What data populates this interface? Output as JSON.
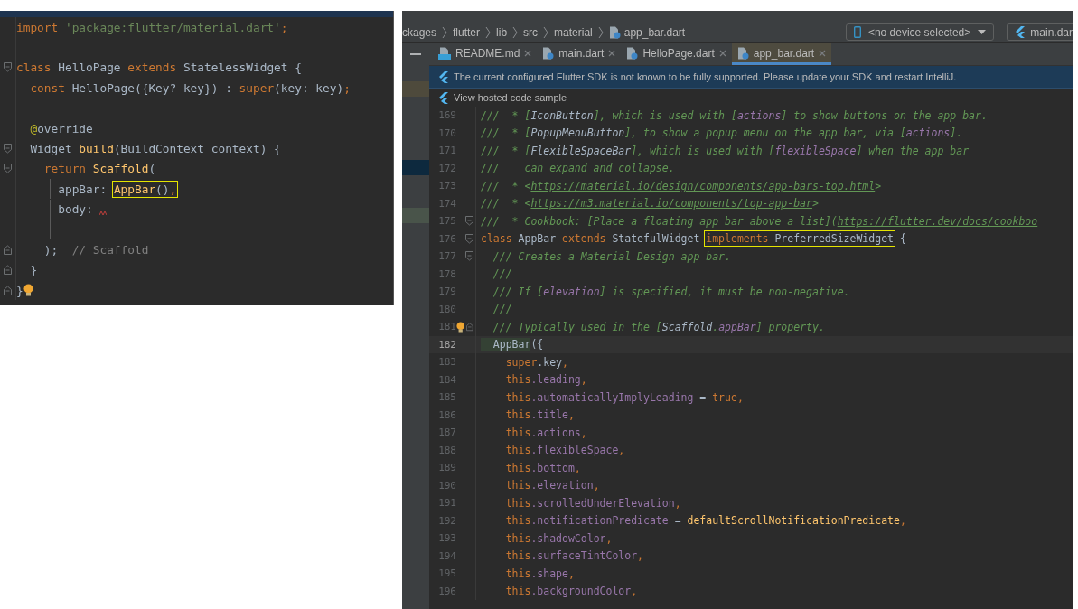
{
  "left_editor": {
    "lines": [
      {
        "kind": "code",
        "tokens": [
          {
            "text": "import",
            "kind": "kw"
          },
          {
            "text": " 'package:flutter/material.dart'",
            "kind": "str"
          },
          {
            "text": ";",
            "kind": "kw"
          }
        ]
      },
      {
        "kind": "blank"
      },
      {
        "fold_open": true,
        "tokens": [
          {
            "text": "class",
            "kind": "kw"
          },
          {
            "text": " HelloPage ",
            "kind": "txt"
          },
          {
            "text": "extends",
            "kind": "kw"
          },
          {
            "text": " StatelessWidget {",
            "kind": "txt"
          }
        ]
      },
      {
        "tokens": [
          {
            "text": "  const",
            "kind": "kw"
          },
          {
            "text": " HelloPage({Key? key}) : ",
            "kind": "txt"
          },
          {
            "text": "super",
            "kind": "kw"
          },
          {
            "text": "(key: key)",
            "kind": "txt"
          },
          {
            "text": ";",
            "kind": "kw"
          }
        ]
      },
      {
        "kind": "blank"
      },
      {
        "tokens": [
          {
            "text": "  @",
            "kind": "ann"
          },
          {
            "text": "override",
            "kind": "txt"
          }
        ]
      },
      {
        "fold_open": true,
        "tokens": [
          {
            "text": "  Widget ",
            "kind": "txt"
          },
          {
            "text": "build",
            "kind": "fn"
          },
          {
            "text": "(BuildContext context) {",
            "kind": "txt"
          }
        ]
      },
      {
        "fold_open": true,
        "tokens": [
          {
            "text": "    return",
            "kind": "kw"
          },
          {
            "text": " Scaffold",
            "kind": "fn"
          },
          {
            "text": "(",
            "kind": "txt"
          }
        ]
      },
      {
        "indent_guide": true,
        "tokens": [
          {
            "text": "      appBar: ",
            "kind": "txt"
          },
          {
            "text": "AppBar",
            "kind": "fn",
            "boxed": true
          },
          {
            "text": "()",
            "kind": "txt",
            "boxed": true
          },
          {
            "text": ",",
            "kind": "kw",
            "boxed": true
          }
        ]
      },
      {
        "indent_guide": true,
        "squiggle": true,
        "tokens": [
          {
            "text": "      body: ",
            "kind": "txt"
          }
        ]
      },
      {
        "kind": "blank",
        "indent_guide": true
      },
      {
        "fold_close": true,
        "tokens": [
          {
            "text": "    );",
            "kind": "txt"
          },
          {
            "text": "  // Scaffold",
            "kind": "cmt"
          }
        ]
      },
      {
        "fold_close": true,
        "tokens": [
          {
            "text": "  }",
            "kind": "txt"
          }
        ]
      },
      {
        "fold_close": true,
        "bulb": true,
        "tokens": [
          {
            "text": "}",
            "kind": "txt"
          }
        ]
      }
    ]
  },
  "ide": {
    "breadcrumbs": [
      "ckages",
      "flutter",
      "lib",
      "src",
      "material",
      "app_bar.dart"
    ],
    "device_selector": "<no device selected>",
    "run_config": "main.dar",
    "tabs": [
      {
        "label": "README.md",
        "kind": "markdown",
        "selected": false
      },
      {
        "label": "main.dart",
        "kind": "dart",
        "selected": false
      },
      {
        "label": "HelloPage.dart",
        "kind": "dart",
        "selected": false
      },
      {
        "label": "app_bar.dart",
        "kind": "dart",
        "selected": true
      }
    ],
    "banner": "The current configured Flutter SDK is not known to be fully supported. Please update your SDK and restart IntelliJ.",
    "code_sample_link": "View hosted code sample",
    "lines": [
      {
        "number": "169",
        "tokens": [
          {
            "text": "///  * [",
            "kind": "doc"
          },
          {
            "text": "IconButton",
            "kind": "dref"
          },
          {
            "text": "], which is used with [",
            "kind": "doc"
          },
          {
            "text": "actions",
            "kind": "dfld"
          },
          {
            "text": "] to show buttons on the app bar.",
            "kind": "doc"
          }
        ]
      },
      {
        "number": "170",
        "tokens": [
          {
            "text": "///  * [",
            "kind": "doc"
          },
          {
            "text": "PopupMenuButton",
            "kind": "dref"
          },
          {
            "text": "], to show a popup menu on the app bar, via [",
            "kind": "doc"
          },
          {
            "text": "actions",
            "kind": "dfld"
          },
          {
            "text": "].",
            "kind": "doc"
          }
        ]
      },
      {
        "number": "171",
        "tokens": [
          {
            "text": "///  * [",
            "kind": "doc"
          },
          {
            "text": "FlexibleSpaceBar",
            "kind": "dref"
          },
          {
            "text": "], which is used with [",
            "kind": "doc"
          },
          {
            "text": "flexibleSpace",
            "kind": "dfld"
          },
          {
            "text": "] when the app bar",
            "kind": "doc"
          }
        ]
      },
      {
        "number": "172",
        "tokens": [
          {
            "text": "///    can expand and collapse.",
            "kind": "doc"
          }
        ]
      },
      {
        "number": "173",
        "tokens": [
          {
            "text": "///  * <",
            "kind": "doc"
          },
          {
            "text": "https://material.io/design/components/app-bars-top.html",
            "kind": "link"
          },
          {
            "text": ">",
            "kind": "doc"
          }
        ]
      },
      {
        "number": "174",
        "tokens": [
          {
            "text": "///  * <",
            "kind": "doc"
          },
          {
            "text": "https://m3.material.io/components/top-app-bar",
            "kind": "link"
          },
          {
            "text": ">",
            "kind": "doc"
          }
        ]
      },
      {
        "number": "175",
        "fold_open": true,
        "tokens": [
          {
            "text": "///  * Cookbook: [Place a floating app bar above a list](",
            "kind": "doc"
          },
          {
            "text": "https://flutter.dev/docs/cookboo",
            "kind": "link"
          }
        ]
      },
      {
        "number": "176",
        "fold_open": true,
        "tokens": [
          {
            "text": "class",
            "kind": "kw"
          },
          {
            "text": " AppBar ",
            "kind": "txt"
          },
          {
            "text": "extends",
            "kind": "kw"
          },
          {
            "text": " StatefulWidget ",
            "kind": "txt"
          },
          {
            "text": "implements",
            "kind": "kw",
            "boxed": true
          },
          {
            "text": " PreferredSizeWidget",
            "kind": "txt",
            "boxed": true
          },
          {
            "text": " {",
            "kind": "txt"
          }
        ]
      },
      {
        "number": "177",
        "fold_open": true,
        "tokens": [
          {
            "text": "  /// Creates a Material Design app bar.",
            "kind": "doc"
          }
        ]
      },
      {
        "number": "178",
        "tokens": [
          {
            "text": "  ///",
            "kind": "doc"
          }
        ]
      },
      {
        "number": "179",
        "tokens": [
          {
            "text": "  /// If [",
            "kind": "doc"
          },
          {
            "text": "elevation",
            "kind": "dfld"
          },
          {
            "text": "] is specified, it must be non-negative.",
            "kind": "doc"
          }
        ]
      },
      {
        "number": "180",
        "tokens": [
          {
            "text": "  ///",
            "kind": "doc"
          }
        ]
      },
      {
        "number": "181",
        "fold_close": true,
        "bulb": true,
        "tokens": [
          {
            "text": "  /// Typically used in the [",
            "kind": "doc"
          },
          {
            "text": "Scaffold",
            "kind": "dref"
          },
          {
            "text": ".",
            "kind": "doc"
          },
          {
            "text": "appBar",
            "kind": "dfld"
          },
          {
            "text": "] property.",
            "kind": "doc"
          }
        ]
      },
      {
        "number": "182",
        "current": true,
        "tokens": [
          {
            "text": "  AppBar",
            "kind": "match"
          },
          {
            "text": "({",
            "kind": "txt"
          }
        ]
      },
      {
        "number": "183",
        "tokens": [
          {
            "text": "    super",
            "kind": "kw"
          },
          {
            "text": ".key",
            "kind": "txt"
          },
          {
            "text": ",",
            "kind": "kw"
          }
        ]
      },
      {
        "number": "184",
        "tokens": [
          {
            "text": "    this",
            "kind": "kw"
          },
          {
            "text": ".leading",
            "kind": "fld"
          },
          {
            "text": ",",
            "kind": "kw"
          }
        ]
      },
      {
        "number": "185",
        "tokens": [
          {
            "text": "    this",
            "kind": "kw"
          },
          {
            "text": ".automaticallyImplyLeading",
            "kind": "fld"
          },
          {
            "text": " = ",
            "kind": "txt"
          },
          {
            "text": "true",
            "kind": "kw"
          },
          {
            "text": ",",
            "kind": "kw"
          }
        ]
      },
      {
        "number": "186",
        "tokens": [
          {
            "text": "    this",
            "kind": "kw"
          },
          {
            "text": ".title",
            "kind": "fld"
          },
          {
            "text": ",",
            "kind": "kw"
          }
        ]
      },
      {
        "number": "187",
        "tokens": [
          {
            "text": "    this",
            "kind": "kw"
          },
          {
            "text": ".actions",
            "kind": "fld"
          },
          {
            "text": ",",
            "kind": "kw"
          }
        ]
      },
      {
        "number": "188",
        "tokens": [
          {
            "text": "    this",
            "kind": "kw"
          },
          {
            "text": ".flexibleSpace",
            "kind": "fld"
          },
          {
            "text": ",",
            "kind": "kw"
          }
        ]
      },
      {
        "number": "189",
        "tokens": [
          {
            "text": "    this",
            "kind": "kw"
          },
          {
            "text": ".bottom",
            "kind": "fld"
          },
          {
            "text": ",",
            "kind": "kw"
          }
        ]
      },
      {
        "number": "190",
        "tokens": [
          {
            "text": "    this",
            "kind": "kw"
          },
          {
            "text": ".elevation",
            "kind": "fld"
          },
          {
            "text": ",",
            "kind": "kw"
          }
        ]
      },
      {
        "number": "191",
        "tokens": [
          {
            "text": "    this",
            "kind": "kw"
          },
          {
            "text": ".scrolledUnderElevation",
            "kind": "fld"
          },
          {
            "text": ",",
            "kind": "kw"
          }
        ]
      },
      {
        "number": "192",
        "tokens": [
          {
            "text": "    this",
            "kind": "kw"
          },
          {
            "text": ".notificationPredicate",
            "kind": "fld"
          },
          {
            "text": " = ",
            "kind": "txt"
          },
          {
            "text": "defaultScrollNotificationPredicate",
            "kind": "fn"
          },
          {
            "text": ",",
            "kind": "kw"
          }
        ]
      },
      {
        "number": "193",
        "tokens": [
          {
            "text": "    this",
            "kind": "kw"
          },
          {
            "text": ".shadowColor",
            "kind": "fld"
          },
          {
            "text": ",",
            "kind": "kw"
          }
        ]
      },
      {
        "number": "194",
        "tokens": [
          {
            "text": "    this",
            "kind": "kw"
          },
          {
            "text": ".surfaceTintColor",
            "kind": "fld"
          },
          {
            "text": ",",
            "kind": "kw"
          }
        ]
      },
      {
        "number": "195",
        "tokens": [
          {
            "text": "    this",
            "kind": "kw"
          },
          {
            "text": ".shape",
            "kind": "fld"
          },
          {
            "text": ",",
            "kind": "kw"
          }
        ]
      },
      {
        "number": "196",
        "tokens": [
          {
            "text": "    this",
            "kind": "kw"
          },
          {
            "text": ".backgroundColor",
            "kind": "fld"
          },
          {
            "text": ",",
            "kind": "kw"
          }
        ]
      }
    ]
  }
}
